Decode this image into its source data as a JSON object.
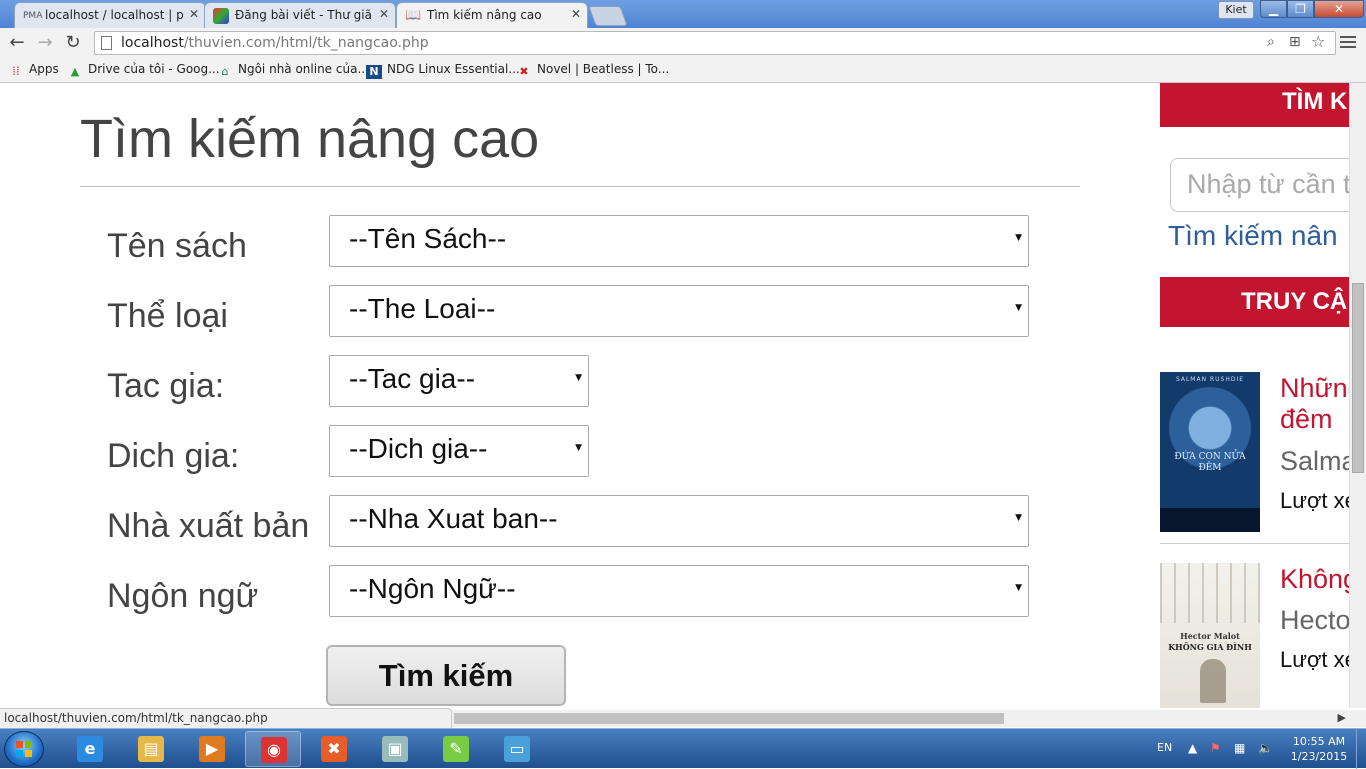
{
  "browser": {
    "tabs": [
      {
        "title": "localhost / localhost | php",
        "icon": "phpmyadmin-icon",
        "icon_text": "PMA"
      },
      {
        "title": "Đăng bài viết - Thư giãn -",
        "icon": "site-logo-icon",
        "icon_text": ""
      },
      {
        "title": "Tìm kiếm nâng cao",
        "icon": "book-icon",
        "icon_text": ""
      }
    ],
    "user_badge": "Kiet",
    "url_host": "localhost",
    "url_path": "/thuvien.com/html/tk_nangcao.php",
    "bookmarks": [
      {
        "label": "Apps",
        "icon": "apps-grid-icon"
      },
      {
        "label": "Drive của tôi - Goog...",
        "icon": "google-drive-icon"
      },
      {
        "label": "Ngôi nhà online của...",
        "icon": "house-icon"
      },
      {
        "label": "NDG Linux Essential...",
        "icon": "ndg-icon",
        "icon_text": "N"
      },
      {
        "label": "Novel | Beatless | To...",
        "icon": "novel-site-icon"
      }
    ]
  },
  "page": {
    "title": "Tìm kiếm nâng cao",
    "form": {
      "fields": [
        {
          "label": "Tên sách",
          "value": "--Tên Sách--"
        },
        {
          "label": "Thể loại",
          "value": "--The Loai--"
        },
        {
          "label": "Tac gia:",
          "value": "--Tac gia--"
        },
        {
          "label": "Dich gia:",
          "value": "--Dich gia--"
        },
        {
          "label": "Nhà xuất bản",
          "value": "--Nha Xuat ban--"
        },
        {
          "label": "Ngôn ngữ",
          "value": "--Ngôn Ngữ--"
        }
      ],
      "submit_label": "Tìm kiếm"
    },
    "sidebar": {
      "search_header": "TÌM K",
      "search_placeholder": "Nhập từ cần t",
      "advanced_link": "Tìm kiếm nân",
      "popular_header": "TRUY CẬ",
      "books": [
        {
          "title_line1": "Những",
          "title_line2": "đêm",
          "author": "Salma",
          "views_label": "Lượt xe",
          "cover_text": "ĐỨA CON NỬA ĐÊM",
          "cover_author": "SALMAN RUSHDIE"
        },
        {
          "title_line1": "Không",
          "title_line2": "",
          "author": "Hecto",
          "views_label": "Lượt xe",
          "cover_text": "KHÔNG GIA ĐÌNH",
          "cover_author": "Hector Malot"
        }
      ]
    },
    "status_url": "localhost/thuvien.com/html/tk_nangcao.php"
  },
  "taskbar": {
    "language": "EN",
    "time": "10:55 AM",
    "date": "1/23/2015",
    "apps": [
      {
        "name": "internet-explorer-icon",
        "glyph": "e",
        "color": "#2a8be0"
      },
      {
        "name": "file-explorer-icon",
        "glyph": "▤",
        "color": "#e6b84a"
      },
      {
        "name": "media-player-icon",
        "glyph": "▶",
        "color": "#e07a20"
      },
      {
        "name": "chrome-icon",
        "glyph": "◉",
        "color": "#d33"
      },
      {
        "name": "xampp-icon",
        "glyph": "✖",
        "color": "#e85c2a"
      },
      {
        "name": "virtual-box-icon",
        "glyph": "▣",
        "color": "#9bb"
      },
      {
        "name": "notepad-plus-icon",
        "glyph": "✎",
        "color": "#7c4"
      },
      {
        "name": "remote-desktop-icon",
        "glyph": "▭",
        "color": "#4aa0d8"
      }
    ]
  },
  "colors": {
    "accent_red": "#c3152f",
    "link_blue": "#2f5d9a"
  }
}
